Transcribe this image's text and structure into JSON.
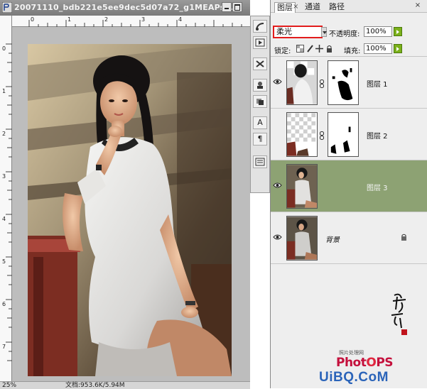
{
  "document": {
    "title": "20071110_bdb221e5ee9dec5d07a72_g1MEAPsh...",
    "zoom": "25%",
    "doc_size": "文档:953.6K/5.94M"
  },
  "rulers": {
    "top_labels": [
      "0",
      "1",
      "2",
      "3",
      "4"
    ],
    "left_labels": [
      "0",
      "1",
      "2",
      "3",
      "4",
      "5",
      "6",
      "7"
    ]
  },
  "tool_strip": {
    "icons": [
      "history-brush-icon",
      "play-icon",
      "tools-icon",
      "stamp-icon",
      "clone-icon",
      "type-icon",
      "paragraph-icon",
      "palette-icon"
    ],
    "type_glyph": "A",
    "paragraph_glyph": "¶"
  },
  "layers_panel": {
    "tabs": [
      {
        "label": "图层",
        "active": true
      },
      {
        "label": "通道",
        "active": false
      },
      {
        "label": "路径",
        "active": false
      }
    ],
    "tab_close": "×",
    "panel_close": "×",
    "blend_mode": "柔光",
    "opacity_label": "不透明度:",
    "opacity_value": "100%",
    "lock_label": "锁定:",
    "fill_label": "填充:",
    "fill_value": "100%",
    "layers": [
      {
        "name": "图层 1",
        "visible": true,
        "selected": false,
        "has_mask": true
      },
      {
        "name": "图层 2",
        "visible": false,
        "selected": false,
        "has_mask": true
      },
      {
        "name": "图层 3",
        "visible": true,
        "selected": true,
        "has_mask": false
      },
      {
        "name": "背景",
        "visible": true,
        "selected": false,
        "has_mask": false,
        "locked": true
      }
    ]
  },
  "watermark": {
    "small": "照片处理网",
    "ps_text": "Phot",
    "ps_o": "O",
    "ps_end": "PS",
    "url": "UiBQ.CoM"
  },
  "colors": {
    "selected_layer": "#8da273",
    "blend_highlight": "#e21c1c",
    "watermark_ps": "#c4103c",
    "watermark_url": "#2b64b9"
  }
}
